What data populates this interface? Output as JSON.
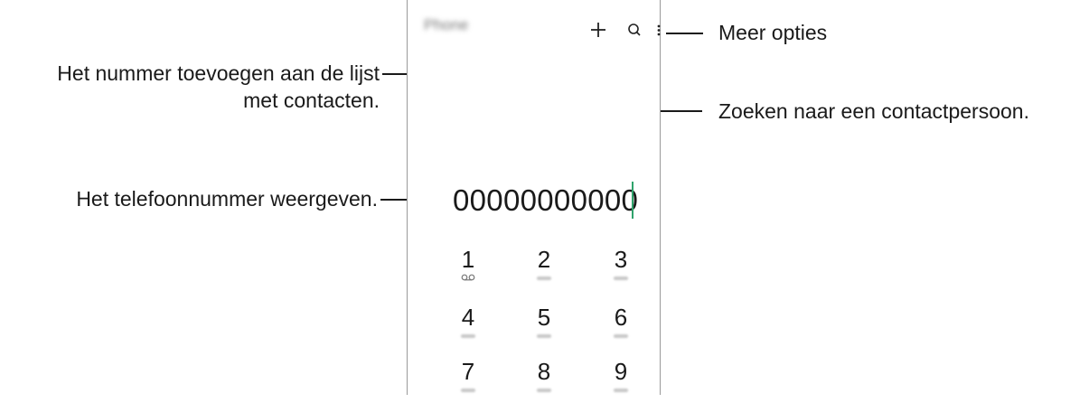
{
  "screen": {
    "title": "Phone",
    "number_display": "00000000000"
  },
  "icons": {
    "add": "plus-icon",
    "search": "search-icon",
    "more": "more-options-icon",
    "voicemail": "voicemail-icon"
  },
  "keypad": [
    {
      "digit": "1"
    },
    {
      "digit": "2"
    },
    {
      "digit": "3"
    },
    {
      "digit": "4"
    },
    {
      "digit": "5"
    },
    {
      "digit": "6"
    },
    {
      "digit": "7"
    },
    {
      "digit": "8"
    },
    {
      "digit": "9"
    }
  ],
  "callouts": {
    "more_options": "Meer opties",
    "add_to_contacts_line1": "Het nummer toevoegen aan de lijst",
    "add_to_contacts_line2": "met contacten.",
    "search_contact": "Zoeken naar een contactpersoon.",
    "show_number": "Het telefoonnummer weergeven."
  },
  "colors": {
    "cursor": "#2fa36b",
    "frame": "#9a9a9a",
    "line": "#1a1a1a"
  }
}
